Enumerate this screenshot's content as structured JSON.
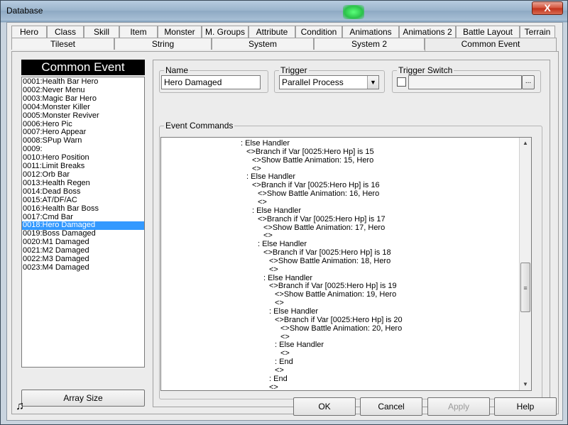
{
  "window": {
    "title": "Database",
    "close_label": "X"
  },
  "tabs_top": [
    "Hero",
    "Class",
    "Skill",
    "Item",
    "Monster",
    "M. Groups",
    "Attribute",
    "Condition",
    "Animations",
    "Animations 2",
    "Battle Layout",
    "Terrain"
  ],
  "tabs_bottom": [
    "Tileset",
    "String",
    "System",
    "System 2",
    "Common Event"
  ],
  "active_tab": "Common Event",
  "common_event": {
    "header": "Common Event",
    "items": [
      "0001:Health Bar Hero",
      "0002:Never Menu",
      "0003:Magic Bar Hero",
      "0004:Monster Killer",
      "0005:Monster Reviver",
      "0006:Hero Pic",
      "0007:Hero Appear",
      "0008:SPup Warn",
      "0009:",
      "0010:Hero Position",
      "0011:Limit Breaks",
      "0012:Orb Bar",
      "0013:Health Regen",
      "0014:Dead Boss",
      "0015:AT/DF/AC",
      "0016:Health Bar Boss",
      "0017:Cmd Bar",
      "0018:Hero Damaged",
      "0019:Boss Damaged",
      "0020:M1 Damaged",
      "0021:M2 Damaged",
      "0022:M3 Damaged",
      "0023:M4 Damaged"
    ],
    "selected_index": 17,
    "array_size_label": "Array Size"
  },
  "name_group": {
    "label": "Name",
    "value": "Hero Damaged"
  },
  "trigger_group": {
    "label": "Trigger",
    "value": "Parallel Process"
  },
  "trigger_switch_group": {
    "label": "Trigger Switch",
    "browse_label": "..."
  },
  "event_commands": {
    "label": "Event Commands",
    "lines": [
      {
        "indent": 0,
        "text": ": Else Handler"
      },
      {
        "indent": 1,
        "text": "<>Branch if Var [0025:Hero Hp] is 15"
      },
      {
        "indent": 2,
        "text": "<>Show Battle Animation: 15, Hero"
      },
      {
        "indent": 2,
        "text": "<>"
      },
      {
        "indent": 1,
        "text": ": Else Handler"
      },
      {
        "indent": 2,
        "text": "<>Branch if Var [0025:Hero Hp] is 16"
      },
      {
        "indent": 3,
        "text": "<>Show Battle Animation: 16, Hero"
      },
      {
        "indent": 3,
        "text": "<>"
      },
      {
        "indent": 2,
        "text": ": Else Handler"
      },
      {
        "indent": 3,
        "text": "<>Branch if Var [0025:Hero Hp] is 17"
      },
      {
        "indent": 4,
        "text": "<>Show Battle Animation: 17, Hero"
      },
      {
        "indent": 4,
        "text": "<>"
      },
      {
        "indent": 3,
        "text": ": Else Handler"
      },
      {
        "indent": 4,
        "text": "<>Branch if Var [0025:Hero Hp] is 18"
      },
      {
        "indent": 5,
        "text": "<>Show Battle Animation: 18, Hero"
      },
      {
        "indent": 5,
        "text": "<>"
      },
      {
        "indent": 4,
        "text": ": Else Handler"
      },
      {
        "indent": 5,
        "text": "<>Branch if Var [0025:Hero Hp] is 19"
      },
      {
        "indent": 6,
        "text": "<>Show Battle Animation: 19, Hero"
      },
      {
        "indent": 6,
        "text": "<>"
      },
      {
        "indent": 5,
        "text": ": Else Handler"
      },
      {
        "indent": 6,
        "text": "<>Branch if Var [0025:Hero Hp] is 20"
      },
      {
        "indent": 7,
        "text": "<>Show Battle Animation: 20, Hero"
      },
      {
        "indent": 7,
        "text": "<>"
      },
      {
        "indent": 6,
        "text": ": Else Handler"
      },
      {
        "indent": 7,
        "text": "<>"
      },
      {
        "indent": 6,
        "text": ": End"
      },
      {
        "indent": 6,
        "text": "<>"
      },
      {
        "indent": 5,
        "text": ": End"
      },
      {
        "indent": 5,
        "text": "<>"
      }
    ]
  },
  "buttons": {
    "ok": "OK",
    "cancel": "Cancel",
    "apply": "Apply",
    "help": "Help"
  },
  "icons": {
    "music": "music-note-icon",
    "dropdown": "chevron-down-icon"
  }
}
